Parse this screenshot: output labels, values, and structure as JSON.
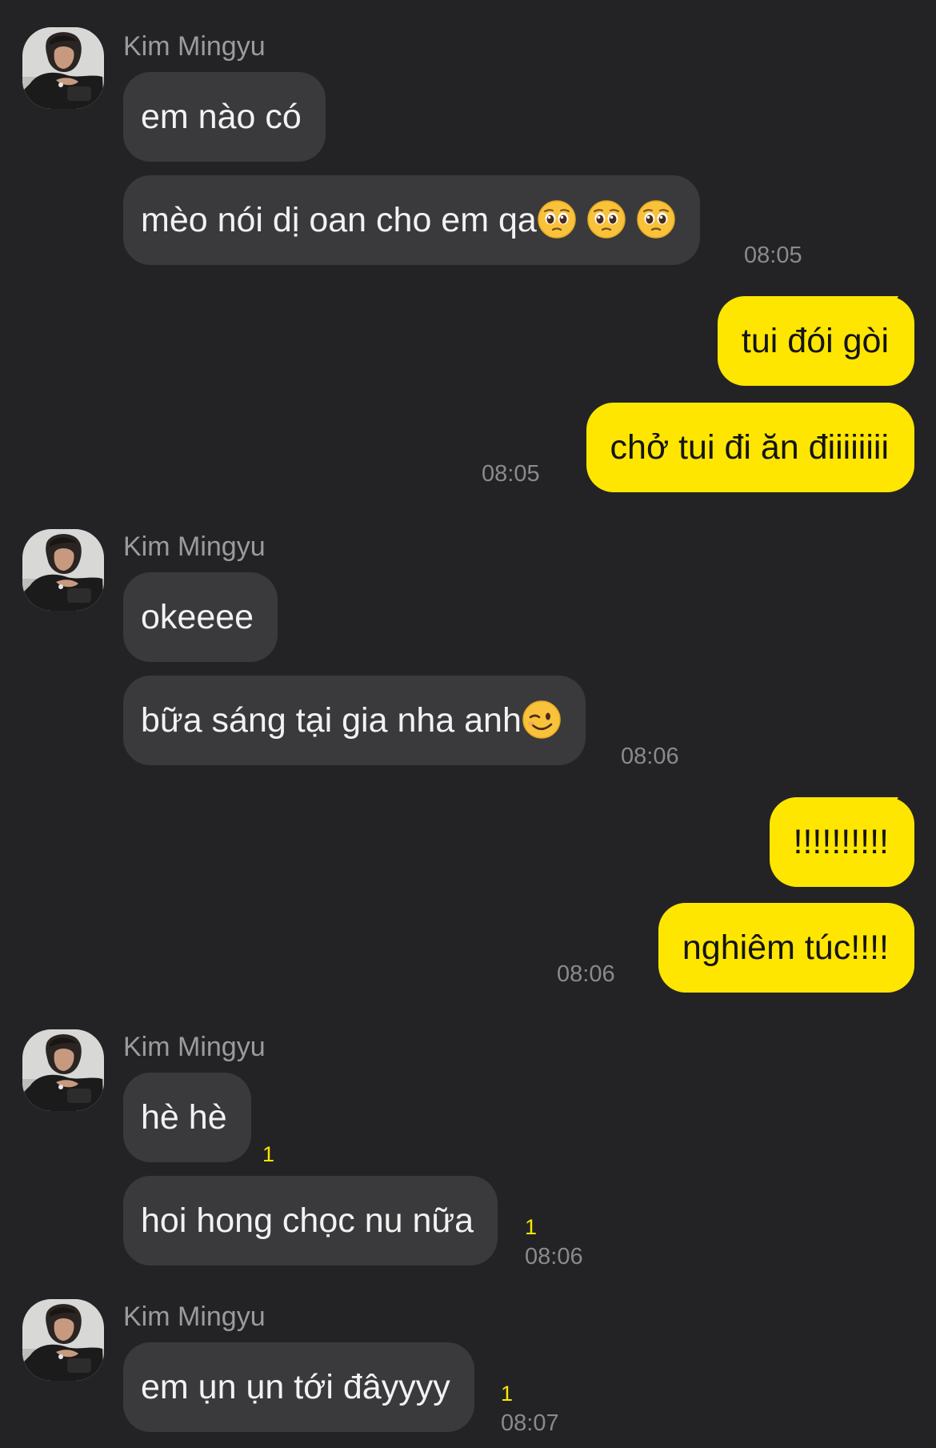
{
  "colors": {
    "background": "#232326",
    "incoming_bubble": "#3a3a3d",
    "outgoing_bubble": "#ffe600",
    "unread_count": "#ffe600",
    "meta_text": "#8a8a8e"
  },
  "groups": [
    {
      "sender": "Kim Mingyu",
      "messages": [
        {
          "text": "em nào có"
        },
        {
          "text": "mèo nói dị oan cho em qa",
          "emojis": [
            "pleading-face-emoji",
            "pleading-face-emoji",
            "pleading-face-emoji"
          ],
          "time": "08:05"
        }
      ]
    },
    {
      "sender": "",
      "messages": [
        {
          "text": "tui đói gòi"
        },
        {
          "text": "chở tui đi ăn điiiiiiii",
          "time": "08:05"
        }
      ]
    },
    {
      "sender": "Kim Mingyu",
      "messages": [
        {
          "text": "okeeee"
        },
        {
          "text": "bữa sáng tại gia nha anh",
          "emojis": [
            "winking-face-emoji"
          ],
          "time": "08:06"
        }
      ]
    },
    {
      "sender": "",
      "messages": [
        {
          "text": "!!!!!!!!!!"
        },
        {
          "text": "nghiêm túc!!!!",
          "time": "08:06"
        }
      ]
    },
    {
      "sender": "Kim Mingyu",
      "messages": [
        {
          "text": "hè hè",
          "unread": "1"
        },
        {
          "text": "hoi hong chọc nu nữa",
          "unread": "1",
          "time": "08:06"
        }
      ]
    },
    {
      "sender": "Kim Mingyu",
      "messages": [
        {
          "text": "em ụn ụn tới đâyyyy",
          "unread": "1",
          "time": "08:07"
        }
      ]
    }
  ]
}
